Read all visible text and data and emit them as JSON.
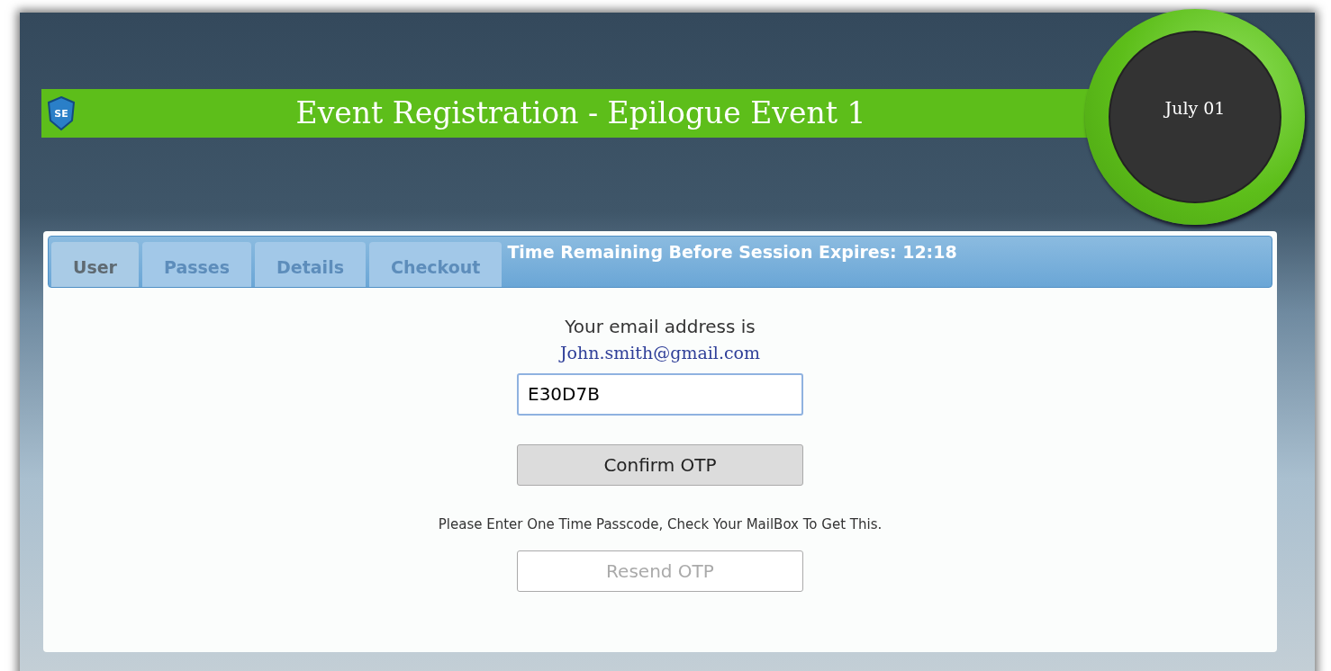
{
  "header": {
    "logo": "SE",
    "title": "Event Registration - Epilogue Event 1",
    "date": "July 01"
  },
  "tabs": [
    {
      "label": "User",
      "selected": true
    },
    {
      "label": "Passes",
      "selected": false
    },
    {
      "label": "Details",
      "selected": false
    },
    {
      "label": "Checkout",
      "selected": false
    }
  ],
  "timer": "Time Remaining Before Session Expires: 12:18",
  "form": {
    "intro": "Your email address is",
    "email": "John.smith@gmail.com",
    "otp_value": "E30D7B",
    "confirm_button": {
      "label": "Confirm OTP",
      "disabled": false
    },
    "hint": "Please Enter One Time Passcode, Check Your MailBox To Get This.",
    "resend_button": {
      "label": "Resend OTP",
      "disabled": true
    }
  }
}
